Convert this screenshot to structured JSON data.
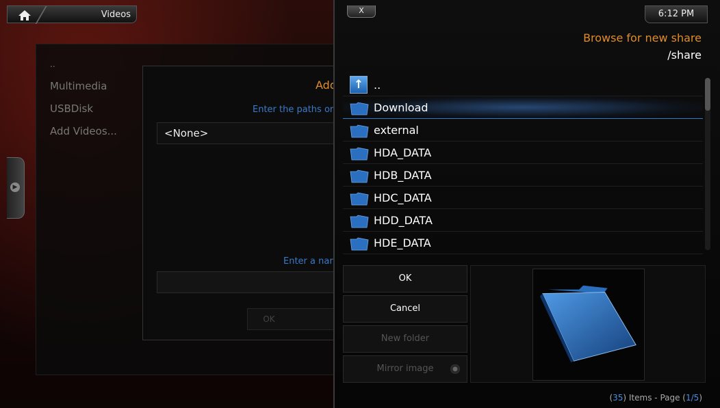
{
  "header": {
    "title": "Videos"
  },
  "background_list": {
    "items": [
      "..",
      "Multimedia",
      "USBDisk",
      "Add Videos..."
    ]
  },
  "add_dialog": {
    "title_visible": "Add",
    "desc_visible": "Enter the paths or",
    "path_value": "<None>",
    "name_label_visible": "Enter a nar",
    "ok_label": "OK"
  },
  "browse_dialog": {
    "close_label": "X",
    "clock": "6:12 PM",
    "title": "Browse for new share",
    "path": "/share",
    "items": [
      {
        "name": "..",
        "type": "up"
      },
      {
        "name": "Download",
        "type": "folder",
        "selected": true
      },
      {
        "name": "external",
        "type": "folder"
      },
      {
        "name": "HDA_DATA",
        "type": "folder"
      },
      {
        "name": "HDB_DATA",
        "type": "folder"
      },
      {
        "name": "HDC_DATA",
        "type": "folder"
      },
      {
        "name": "HDD_DATA",
        "type": "folder"
      },
      {
        "name": "HDE_DATA",
        "type": "folder"
      }
    ],
    "buttons": {
      "ok": "OK",
      "cancel": "Cancel",
      "new_folder": "New folder",
      "mirror_image": "Mirror image"
    },
    "footer": {
      "prefix": "(",
      "count": "35",
      "items_text": ") Items - Page (",
      "page": "1/5",
      "suffix": ")"
    },
    "colors": {
      "accent": "#e08c2c",
      "link": "#4a8fe0",
      "folder": "#2b6fc0"
    }
  }
}
